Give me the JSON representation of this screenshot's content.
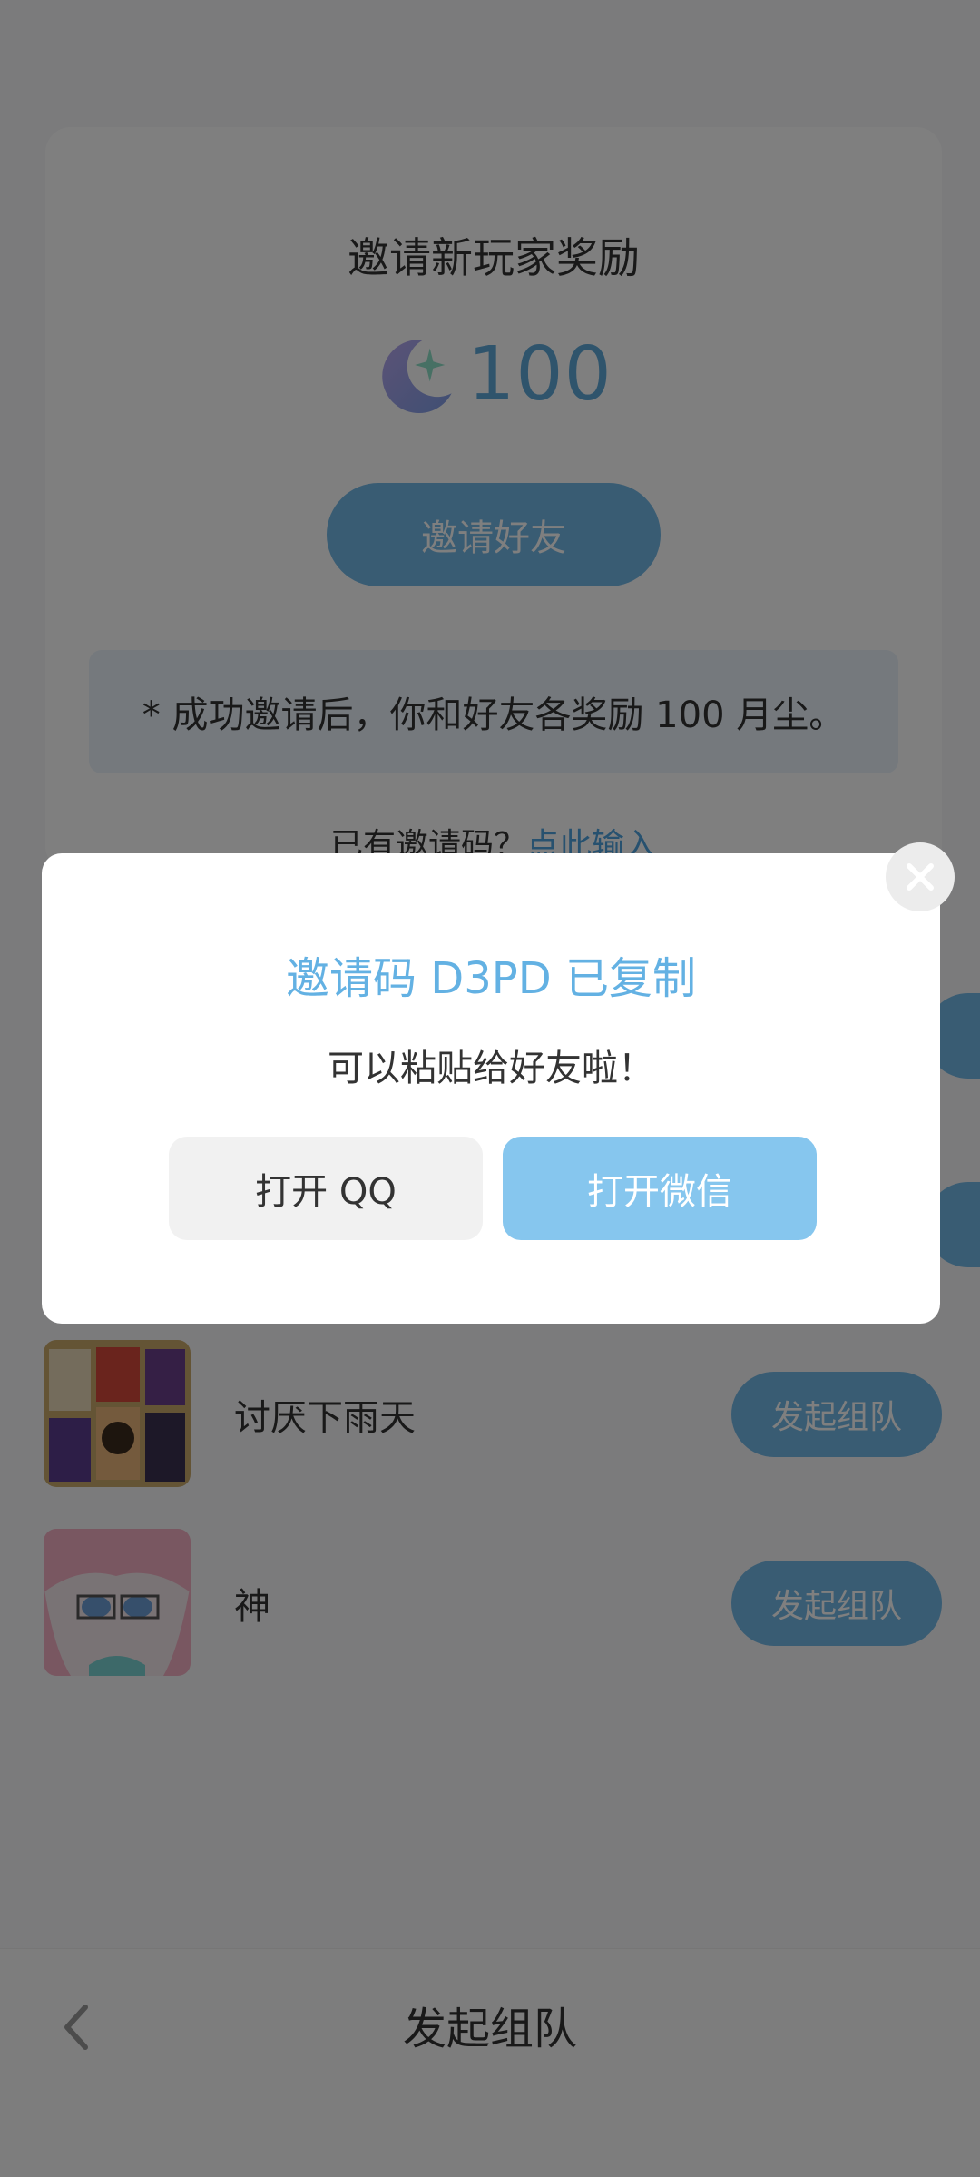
{
  "invite_card": {
    "title": "邀请新玩家奖励",
    "reward_amount": "100",
    "invite_button": "邀请好友",
    "note": "* 成功邀请后，你和好友各奖励 100 月尘。",
    "has_code_text": "已有邀请码？",
    "has_code_link": "点此输入"
  },
  "team_list": [
    {
      "name": "讨厌下雨天",
      "button": "发起组队"
    },
    {
      "name": "神",
      "button": "发起组队"
    }
  ],
  "bottom_bar": {
    "title": "发起组队"
  },
  "modal": {
    "title": "邀请码 D3PD 已复制",
    "subtitle": "可以粘贴给好友啦！",
    "btn_qq": "打开 QQ",
    "btn_wechat": "打开微信"
  },
  "colors": {
    "accent": "#72b8e6",
    "link": "#4fa3df",
    "modal_title": "#63b1e3"
  },
  "icons": {
    "reward": "moon-star-icon",
    "close": "close-icon",
    "back": "chevron-left-icon"
  }
}
